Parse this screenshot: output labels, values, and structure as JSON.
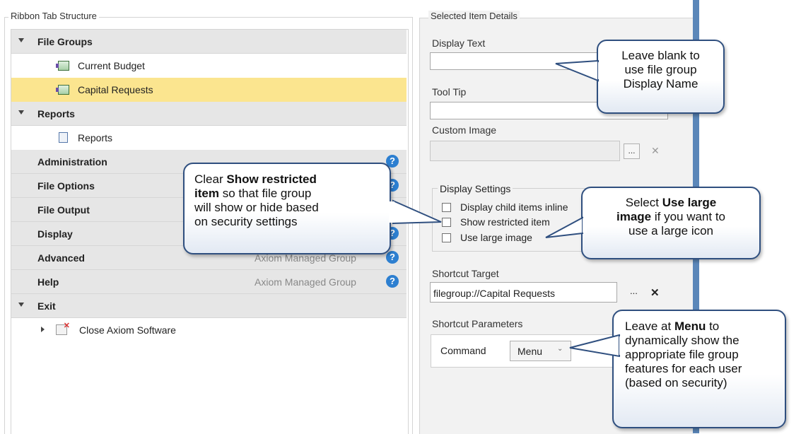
{
  "left": {
    "title": "Ribbon Tab Structure",
    "rows": [
      {
        "label": "File Groups"
      },
      {
        "label": "Current Budget"
      },
      {
        "label": "Capital Requests"
      },
      {
        "label": "Reports"
      },
      {
        "label": "Reports"
      },
      {
        "label": "Administration"
      },
      {
        "label": "File Options"
      },
      {
        "label": "File Output"
      },
      {
        "label": "Display"
      },
      {
        "label": "Advanced"
      },
      {
        "label": "Help"
      },
      {
        "label": "Exit"
      },
      {
        "label": "Close Axiom Software"
      }
    ],
    "managed_text": "Axiom Managed Group",
    "help_glyph": "?"
  },
  "right": {
    "title": "Selected Item Details",
    "display_text": {
      "label": "Display Text",
      "value": ""
    },
    "tool_tip": {
      "label": "Tool Tip",
      "value": ""
    },
    "custom_image": {
      "label": "Custom Image",
      "value": "",
      "browse": "...",
      "clear": "✕"
    },
    "display_settings": {
      "title": "Display Settings",
      "options": [
        {
          "label": "Display child items inline",
          "checked": false
        },
        {
          "label": "Show restricted item",
          "checked": false
        },
        {
          "label": "Use large image",
          "checked": false
        }
      ]
    },
    "shortcut_target": {
      "label": "Shortcut Target",
      "value": "filegroup://Capital Requests",
      "browse": "...",
      "clear": "✕"
    },
    "shortcut_parameters": {
      "label": "Shortcut Parameters",
      "command_label": "Command",
      "command_value": "Menu"
    }
  },
  "callouts": {
    "c1": {
      "l1": "Leave blank to",
      "l2": "use file group",
      "l3": "Display Name"
    },
    "c2": {
      "l1": "Clear ",
      "b1": "Show restricted",
      "b2": "item",
      "l2": " so that file group",
      "l3": "will show or hide based",
      "l4": "on security settings"
    },
    "c3": {
      "l1a": "Select ",
      "b1": "Use large",
      "b2": "image",
      "l2": " if you want to",
      "l3": "use a large icon"
    },
    "c4": {
      "l1a": "Leave at ",
      "b1": "Menu",
      "l1b": " to",
      "l2": "dynamically show the",
      "l3": "appropriate file group",
      "l4": "features for each user",
      "l5": "(based on security)"
    }
  },
  "colors": {
    "selected_row": "#fbe58f",
    "section_row": "#e6e6e6",
    "help_icon": "#2d7fd0",
    "callout_border": "#2f4f7f",
    "scroll_strip": "#5b87b9"
  }
}
